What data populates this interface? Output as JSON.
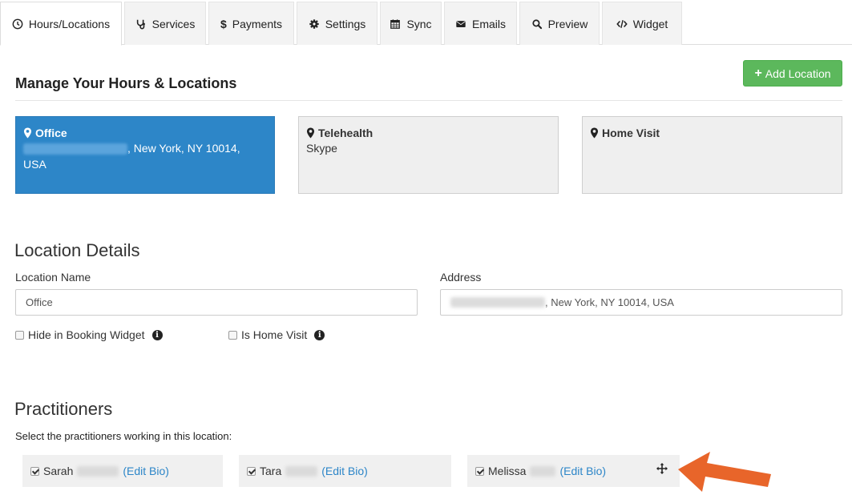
{
  "tabs": [
    {
      "label": "Hours/Locations",
      "icon": "clock-icon",
      "active": true
    },
    {
      "label": "Services",
      "icon": "stethoscope-icon"
    },
    {
      "label": "Payments",
      "icon": "dollar-icon"
    },
    {
      "label": "Settings",
      "icon": "gear-icon"
    },
    {
      "label": "Sync",
      "icon": "calendar-icon"
    },
    {
      "label": "Emails",
      "icon": "envelope-icon"
    },
    {
      "label": "Preview",
      "icon": "search-icon"
    },
    {
      "label": "Widget",
      "icon": "code-icon"
    }
  ],
  "header": {
    "title": "Manage Your Hours & Locations",
    "add_location_label": "Add Location"
  },
  "locations": [
    {
      "name": "Office",
      "address_suffix": ", New York, NY 10014,",
      "address_line2": "USA"
    },
    {
      "name": "Telehealth",
      "sub": "Skype"
    },
    {
      "name": "Home Visit"
    }
  ],
  "details": {
    "title": "Location Details",
    "location_name_label": "Location Name",
    "location_name_value": "Office",
    "address_label": "Address",
    "address_value_suffix": ", New York, NY 10014, USA",
    "hide_in_widget_label": "Hide in Booking Widget",
    "is_home_visit_label": "Is Home Visit"
  },
  "practitioners": {
    "title": "Practitioners",
    "subtitle": "Select the practitioners working in this location:",
    "items": [
      {
        "first_name": "Sarah",
        "edit_label": "(Edit Bio)",
        "checked": true
      },
      {
        "first_name": "Tara",
        "edit_label": "(Edit Bio)",
        "checked": true
      },
      {
        "first_name": "Melissa",
        "edit_label": "(Edit Bio)",
        "checked": true
      }
    ]
  },
  "colors": {
    "active_card": "#2d86c8",
    "add_button": "#5cb85c",
    "link": "#2d86c8",
    "arrow": "#e8652a"
  }
}
